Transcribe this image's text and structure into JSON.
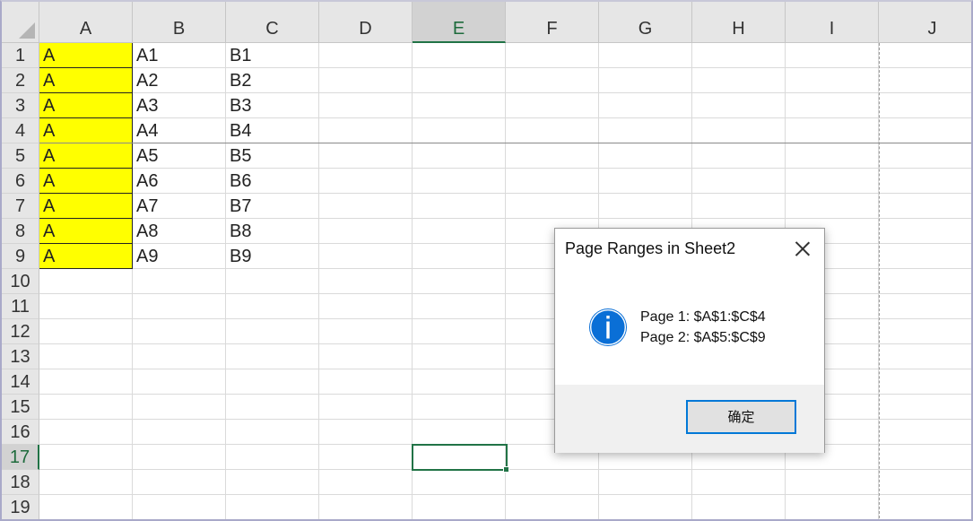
{
  "grid": {
    "columns": [
      "A",
      "B",
      "C",
      "D",
      "E",
      "F",
      "G",
      "H",
      "I",
      "J"
    ],
    "selected_column": "E",
    "rows": [
      "1",
      "2",
      "3",
      "4",
      "5",
      "6",
      "7",
      "8",
      "9",
      "10",
      "11",
      "12",
      "13",
      "14",
      "15",
      "16",
      "17",
      "18",
      "19"
    ],
    "selected_row": "17",
    "cells": {
      "A": [
        "A",
        "A",
        "A",
        "A",
        "A",
        "A",
        "A",
        "A",
        "A"
      ],
      "B": [
        "A1",
        "A2",
        "A3",
        "A4",
        "A5",
        "A6",
        "A7",
        "A8",
        "A9"
      ],
      "C": [
        "B1",
        "B2",
        "B3",
        "B4",
        "B5",
        "B6",
        "B7",
        "B8",
        "B9"
      ]
    },
    "highlight_color": "#ffff00",
    "selection_color": "#217346"
  },
  "dialog": {
    "title": "Page Ranges in Sheet2",
    "icon": "info-icon",
    "lines": [
      "Page 1: $A$1:$C$4",
      "Page 2: $A$5:$C$9"
    ],
    "ok_label": "确定",
    "icon_color": "#0a6fd6"
  }
}
